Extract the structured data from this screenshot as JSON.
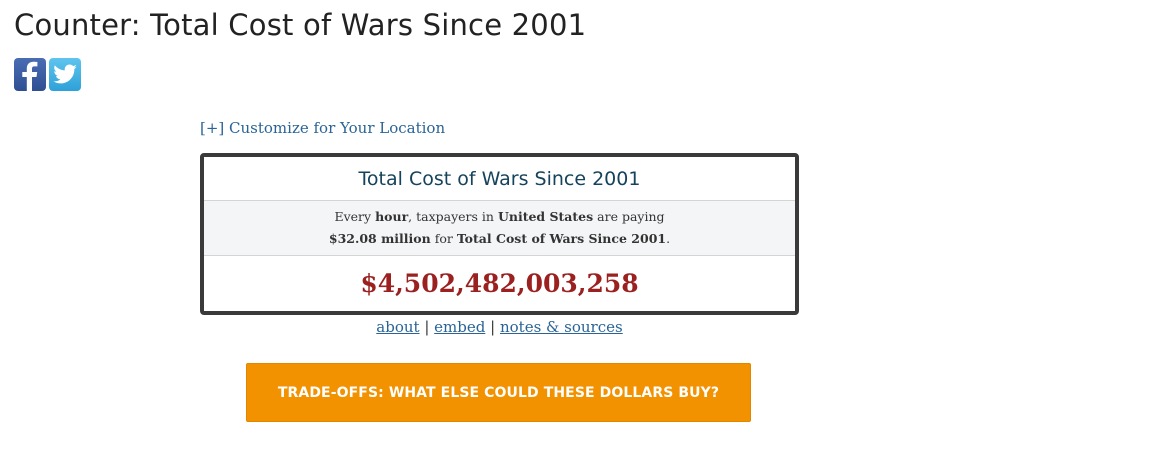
{
  "page": {
    "title": "Counter: Total Cost of Wars Since 2001"
  },
  "social": {
    "facebook_icon": "facebook-icon",
    "twitter_icon": "twitter-icon",
    "facebook_color": "#3b5998",
    "twitter_color": "#3aaee3"
  },
  "customize_link": "[+] Customize for Your Location",
  "counter": {
    "title": "Total Cost of Wars Since 2001",
    "desc_prefix": "Every ",
    "desc_period": "hour",
    "desc_mid": ", taxpayers in ",
    "desc_location": "United States",
    "desc_suffix": " are paying",
    "desc_rate": "$32.08 million",
    "desc_for": " for ",
    "desc_subject": "Total Cost of Wars Since 2001",
    "desc_end": ".",
    "value": "$4,502,482,003,258",
    "value_color": "#9b2020"
  },
  "links": {
    "about": "about",
    "separator": "|",
    "embed": "embed",
    "notes": "notes & sources"
  },
  "tradeoffs_button": {
    "label": "TRADE-OFFS: WHAT ELSE COULD THESE DOLLARS BUY?",
    "color": "#f39200"
  }
}
